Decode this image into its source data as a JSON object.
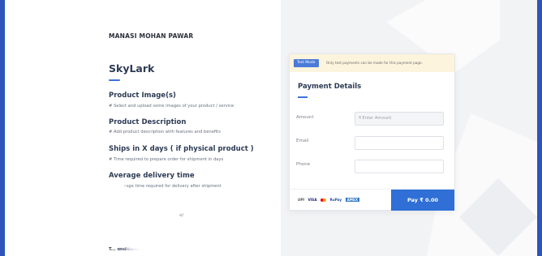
{
  "merchant": {
    "name": "MANASI MOHAN PAWAR"
  },
  "store": {
    "title": "SkyLark"
  },
  "sections": [
    {
      "title": "Product Image(s)",
      "desc": "# Select and upload some images of your product / service"
    },
    {
      "title": "Product Description",
      "desc": "# Add product description with features and benefits"
    },
    {
      "title": "Ships in X days ( if physical product )",
      "desc": "# Time required to prepare order for shipment in days"
    },
    {
      "title": "Average delivery time",
      "desc": "rage time required for delivery after shipment"
    }
  ],
  "partial_texts": {
    "fragment": "e/",
    "terms": "T... onditions"
  },
  "payment": {
    "test_badge": "Test Mode",
    "test_note": "Only test payments can be made for this payment page.",
    "title": "Payment Details",
    "fields": {
      "amount_label": "Amount",
      "amount_placeholder": "Enter Amount",
      "amount_currency": "₹",
      "email_label": "Email",
      "phone_label": "Phone"
    },
    "methods": {
      "upi": "UPI",
      "visa": "VISA",
      "rupay": "RuPay",
      "amex": "AMEX"
    },
    "pay_button": "Pay ₹ 0.00"
  },
  "colors": {
    "accent": "#2f6fd6",
    "frame": "#2d55b9",
    "banner": "#fdf4dd"
  }
}
